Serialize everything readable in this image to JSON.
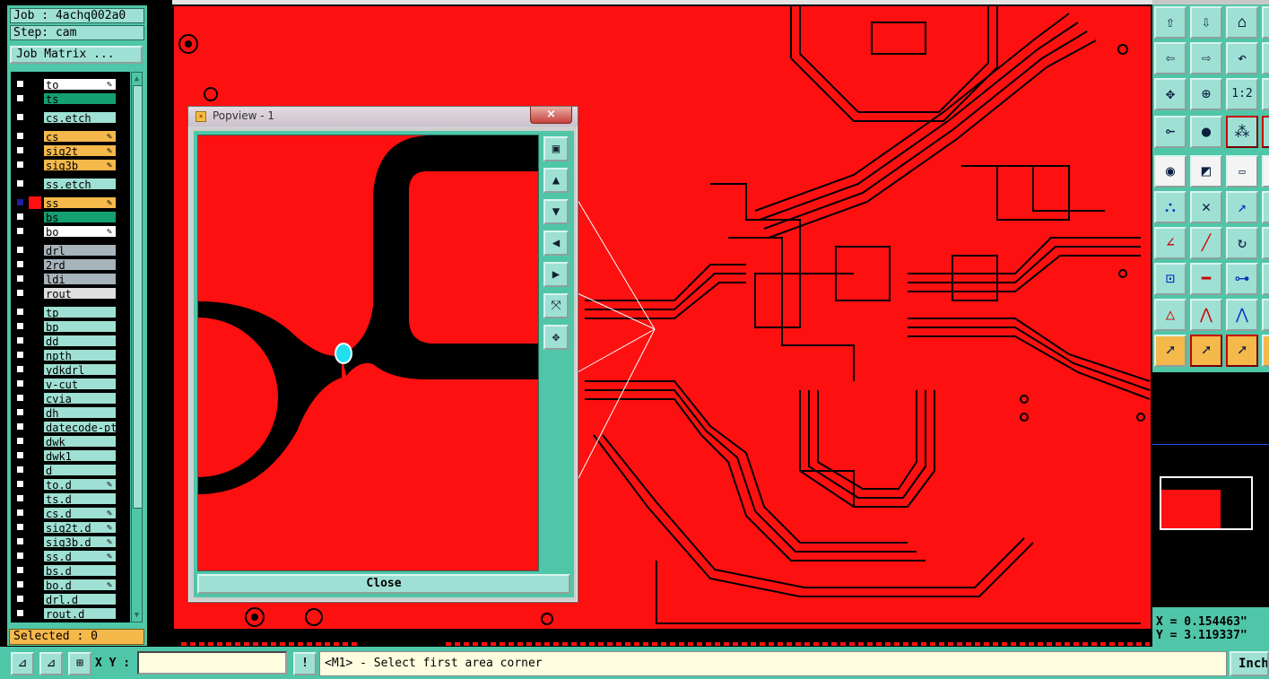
{
  "header": {
    "job": "Job : 4achq002a0",
    "step": "Step: cam",
    "job_matrix": "Job Matrix ..."
  },
  "layers": [
    {
      "name": "to",
      "color": "#ffffff",
      "edit": true
    },
    {
      "name": "ts",
      "color": "#14a070",
      "edit": false
    },
    {
      "name": "cs.etch",
      "color": "#9fe0d4",
      "edit": false
    },
    {
      "name": "cs",
      "color": "#f5b84b",
      "edit": true
    },
    {
      "name": "sig2t",
      "color": "#f5b84b",
      "edit": true
    },
    {
      "name": "sig3b",
      "color": "#f5b84b",
      "edit": true
    },
    {
      "name": "ss.etch",
      "color": "#9fe0d4",
      "edit": false
    },
    {
      "name": "ss",
      "color": "#f5b84b",
      "edit": true,
      "active": true
    },
    {
      "name": "bs",
      "color": "#14a070",
      "edit": false
    },
    {
      "name": "bo",
      "color": "#ffffff",
      "edit": true
    },
    {
      "name": "drl",
      "color": "#a8b4bc",
      "edit": false
    },
    {
      "name": "2rd",
      "color": "#a8b4bc",
      "edit": false
    },
    {
      "name": "ldi",
      "color": "#a8b4bc",
      "edit": false
    },
    {
      "name": "rout",
      "color": "#e0e0e0",
      "edit": false
    },
    {
      "name": "tp",
      "color": "#9fe0d4",
      "edit": false
    },
    {
      "name": "bp",
      "color": "#9fe0d4",
      "edit": false
    },
    {
      "name": "dd",
      "color": "#9fe0d4",
      "edit": false
    },
    {
      "name": "npth",
      "color": "#9fe0d4",
      "edit": false
    },
    {
      "name": "ydkdrl",
      "color": "#9fe0d4",
      "edit": false
    },
    {
      "name": "v-cut",
      "color": "#9fe0d4",
      "edit": false
    },
    {
      "name": "cvia",
      "color": "#9fe0d4",
      "edit": false
    },
    {
      "name": "dh",
      "color": "#9fe0d4",
      "edit": false
    },
    {
      "name": "datecode-pto",
      "color": "#9fe0d4",
      "edit": false
    },
    {
      "name": "dwk",
      "color": "#9fe0d4",
      "edit": false
    },
    {
      "name": "dwk1",
      "color": "#9fe0d4",
      "edit": false
    },
    {
      "name": "d",
      "color": "#9fe0d4",
      "edit": false
    },
    {
      "name": "to.d",
      "color": "#9fe0d4",
      "edit": true
    },
    {
      "name": "ts.d",
      "color": "#9fe0d4",
      "edit": false
    },
    {
      "name": "cs.d",
      "color": "#9fe0d4",
      "edit": true
    },
    {
      "name": "sig2t.d",
      "color": "#9fe0d4",
      "edit": true
    },
    {
      "name": "sig3b.d",
      "color": "#9fe0d4",
      "edit": true
    },
    {
      "name": "ss.d",
      "color": "#9fe0d4",
      "edit": true
    },
    {
      "name": "bs.d",
      "color": "#9fe0d4",
      "edit": false
    },
    {
      "name": "bo.d",
      "color": "#9fe0d4",
      "edit": true
    },
    {
      "name": "drl.d",
      "color": "#9fe0d4",
      "edit": false
    },
    {
      "name": "rout.d",
      "color": "#9fe0d4",
      "edit": false
    }
  ],
  "selected": "Selected : 0",
  "popview": {
    "title": "Popview - 1",
    "close_x": "×",
    "close_label": "Close"
  },
  "status": {
    "xy_label": "X Y :",
    "xy_value": "",
    "message": "<M1> - Select first area corner",
    "units": "Inch",
    "coords": "X = 0.154463\"\nY = 3.119337\""
  },
  "colors": {
    "copper": "#ff1010",
    "panel": "#4fc6a8",
    "button": "#9fe0d4"
  }
}
